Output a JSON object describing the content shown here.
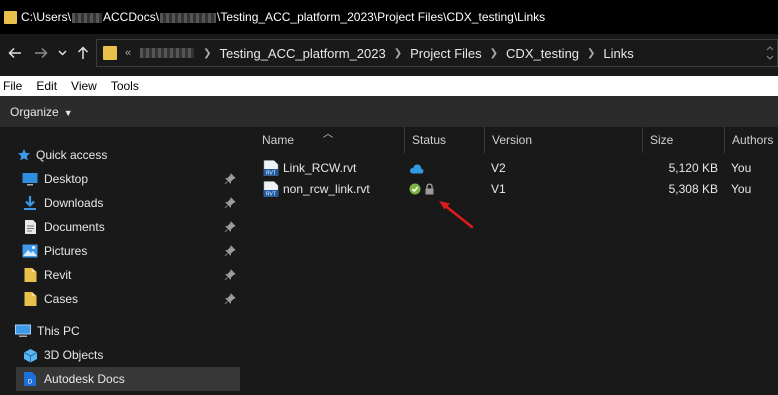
{
  "window": {
    "title_prefix": "C:\\Users\\",
    "title_mid": "ACCDocs\\",
    "title_suffix": "\\Testing_ACC_platform_2023\\Project Files\\CDX_testing\\Links"
  },
  "navigation": {
    "back_icon": "arrow-left-icon",
    "forward_icon": "arrow-right-icon",
    "recent_icon": "chevron-down-icon",
    "up_icon": "arrow-up-icon",
    "overflow": "«",
    "breadcrumbs": [
      "Testing_ACC_platform_2023",
      "Project Files",
      "CDX_testing",
      "Links"
    ]
  },
  "menu": [
    "File",
    "Edit",
    "View",
    "Tools"
  ],
  "toolbar": {
    "organize_label": "Organize"
  },
  "sidebar": {
    "quick_access": "Quick access",
    "pinned": [
      {
        "label": "Desktop",
        "icon": "desktop-icon"
      },
      {
        "label": "Downloads",
        "icon": "download-icon"
      },
      {
        "label": "Documents",
        "icon": "documents-icon"
      },
      {
        "label": "Pictures",
        "icon": "pictures-icon"
      },
      {
        "label": "Revit",
        "icon": "folder-icon"
      },
      {
        "label": "Cases",
        "icon": "folder-icon"
      }
    ],
    "this_pc": "This PC",
    "pc_items": [
      {
        "label": "3D Objects",
        "icon": "3d-objects-icon"
      },
      {
        "label": "Autodesk Docs",
        "icon": "autodesk-docs-icon",
        "selected": true
      }
    ]
  },
  "columns": {
    "name": "Name",
    "status": "Status",
    "version": "Version",
    "size": "Size",
    "authors": "Authors"
  },
  "files": [
    {
      "name": "Link_RCW.rvt",
      "status": "cloud",
      "version": "V2",
      "size": "5,120 KB",
      "author": "You"
    },
    {
      "name": "non_rcw_link.rvt",
      "status": "synced-locked",
      "version": "V1",
      "size": "5,308 KB",
      "author": "You"
    }
  ],
  "colors": {
    "folder": "#e8c04a",
    "cloud": "#2f9ae0",
    "synced": "#7cb342",
    "annotation_arrow": "#e01b1b",
    "selected": "#373737"
  }
}
